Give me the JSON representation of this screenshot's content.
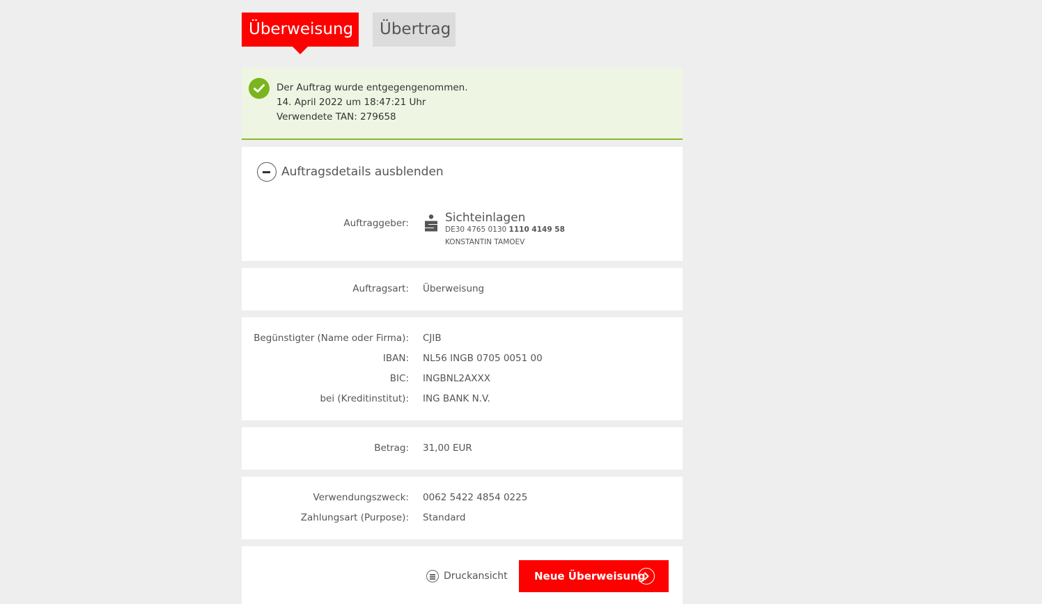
{
  "tabs": {
    "active": "Überweisung",
    "inactive": "Übertrag"
  },
  "success": {
    "line1": "Der Auftrag wurde entgegengenommen.",
    "line2": "14. April 2022 um 18:47:21 Uhr",
    "line3": "Verwendete TAN: 279658"
  },
  "details": {
    "toggle_label": "Auftragsdetails ausblenden",
    "auftraggeber_label": "Auftraggeber:",
    "account_name": "Sichteinlagen",
    "account_iban_prefix": "DE30 4765 0130",
    "account_iban_bold": "1110 4149 58",
    "account_owner": "KONSTANTIN TAMOEV"
  },
  "order_type": {
    "label": "Auftragsart:",
    "value": "Überweisung"
  },
  "beneficiary": {
    "name_label": "Begünstigter (Name oder Firma):",
    "name_value": "CJIB",
    "iban_label": "IBAN:",
    "iban_value": "NL56 INGB 0705 0051 00",
    "bic_label": "BIC:",
    "bic_value": "INGBNL2AXXX",
    "bank_label": "bei (Kreditinstitut):",
    "bank_value": "ING BANK N.V."
  },
  "amount": {
    "label": "Betrag:",
    "value": "31,00 EUR"
  },
  "purpose": {
    "reference_label": "Verwendungszweck:",
    "reference_value": "0062 5422 4854 0225",
    "type_label": "Zahlungsart (Purpose):",
    "type_value": "Standard"
  },
  "actions": {
    "print_label": "Druckansicht",
    "new_transfer_label": "Neue Überweisung"
  },
  "colors": {
    "brand_red": "#ff0000",
    "success_green": "#7ab51d",
    "success_bg": "#eef6e3"
  }
}
